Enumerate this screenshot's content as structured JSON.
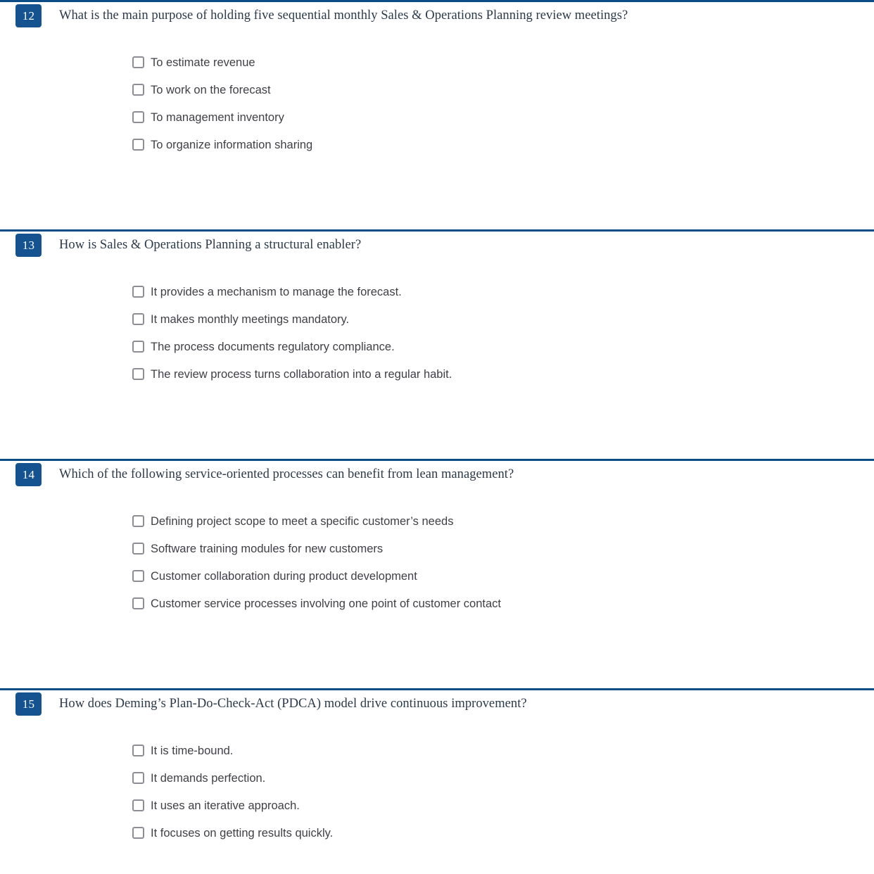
{
  "page": {
    "kind": "quiz",
    "accent_color": "#0c4d87",
    "badge_color": "#14538f",
    "question_text_color": "#2b3a4a",
    "option_text_color": "#3f3f46",
    "checkbox_border_color": "#8d8d97",
    "checkbox_state": "unchecked"
  },
  "questions": [
    {
      "number": "12",
      "text": "What is the main purpose of holding five sequential monthly Sales & Operations Planning review meetings?",
      "options": [
        "To estimate revenue",
        "To work on the forecast",
        "To management inventory",
        "To organize information sharing"
      ]
    },
    {
      "number": "13",
      "text": "How is Sales & Operations Planning a structural enabler?",
      "options": [
        "It provides a mechanism to manage the forecast.",
        "It makes monthly meetings mandatory.",
        "The process documents regulatory compliance.",
        "The review process turns collaboration into a regular habit."
      ]
    },
    {
      "number": "14",
      "text": "Which of the following service-oriented processes can benefit from lean management?",
      "options": [
        "Defining project scope to meet a specific customer’s needs",
        "Software training modules for new customers",
        "Customer collaboration during product development",
        "Customer service processes involving one point of customer contact"
      ]
    },
    {
      "number": "15",
      "text": "How does Deming’s Plan-Do-Check-Act (PDCA) model drive continuous improvement?",
      "options": [
        "It is time-bound.",
        "It demands perfection.",
        "It uses an iterative approach.",
        "It focuses on getting results quickly."
      ]
    }
  ]
}
